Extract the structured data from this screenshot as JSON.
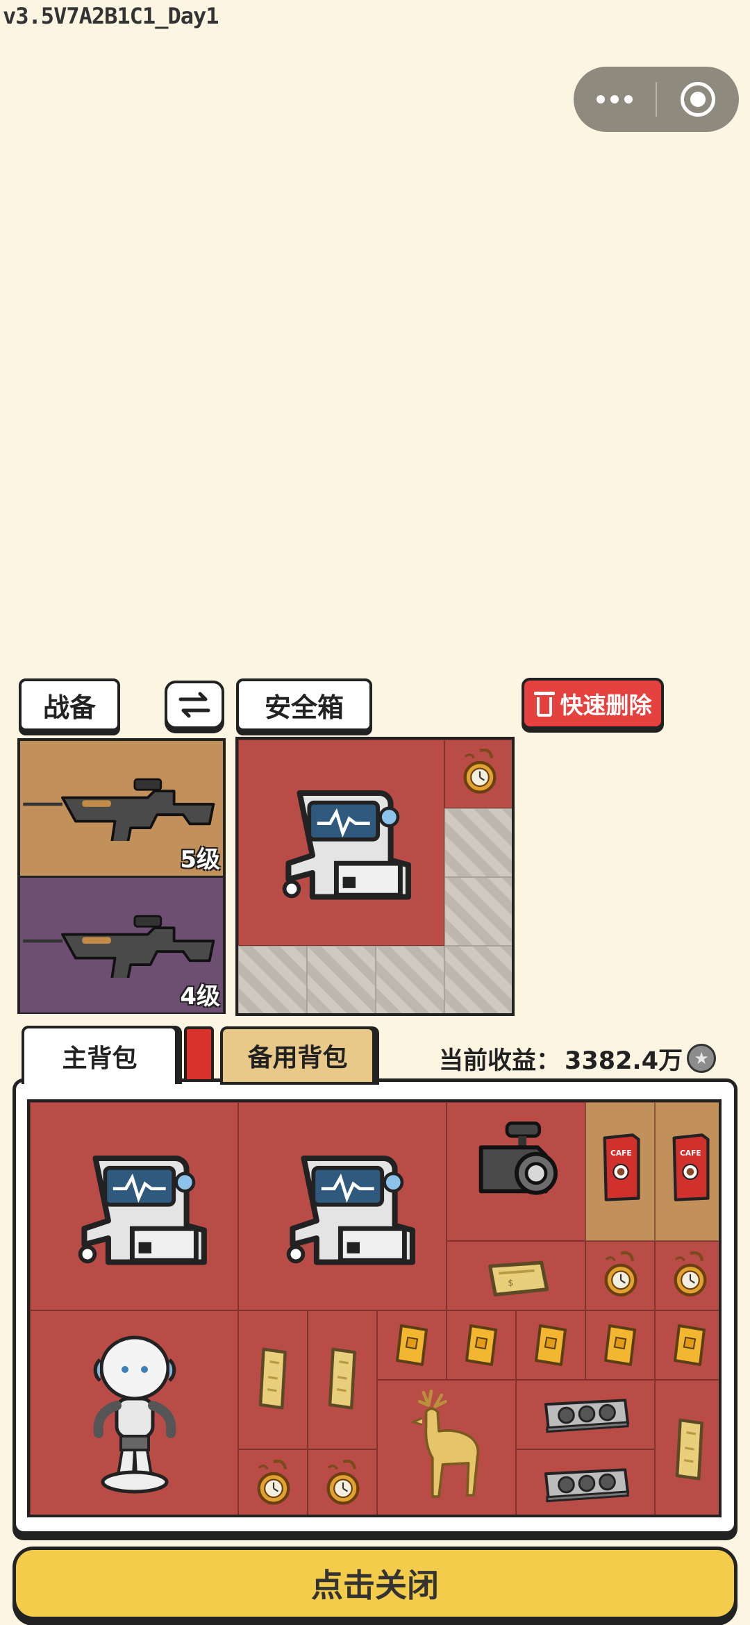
{
  "version_label": "v3.5V7A2B1C1_Day1",
  "capsule": {
    "more_icon": "more-dots-icon",
    "close_icon": "target-icon"
  },
  "tabs": {
    "gear": "战备",
    "swap_icon": "swap-arrows-icon",
    "safebox": "安全箱"
  },
  "quick_delete": {
    "label": "快速删除",
    "icon": "trash-icon"
  },
  "weapons": [
    {
      "level": "5级",
      "bg": "#c2915b",
      "icon": "rifle-icon"
    },
    {
      "level": "4级",
      "bg": "#6e4f73",
      "icon": "rifle-icon"
    }
  ],
  "safebox_items": [
    "ecg-machine-icon",
    "pocket-watch-icon"
  ],
  "backpack": {
    "main_tab": "主背包",
    "backup_tab": "备用背包",
    "earnings_label": "当前收益：",
    "earnings_value": "3382.4万",
    "items": [
      "ecg-machine-icon",
      "ecg-machine-icon",
      "camera-icon",
      "coffee-box-icon",
      "coffee-box-icon",
      "gold-bar-icon",
      "pocket-watch-icon",
      "pocket-watch-icon",
      "robot-icon",
      "gold-bar-icon",
      "gold-bar-icon",
      "gold-card-icon",
      "gold-card-icon",
      "gold-card-icon",
      "gold-card-icon",
      "gold-card-icon",
      "golden-deer-icon",
      "gpu-card-icon",
      "gpu-card-icon",
      "gold-bar-icon",
      "pocket-watch-icon",
      "pocket-watch-icon"
    ]
  },
  "close_button": "点击关闭"
}
